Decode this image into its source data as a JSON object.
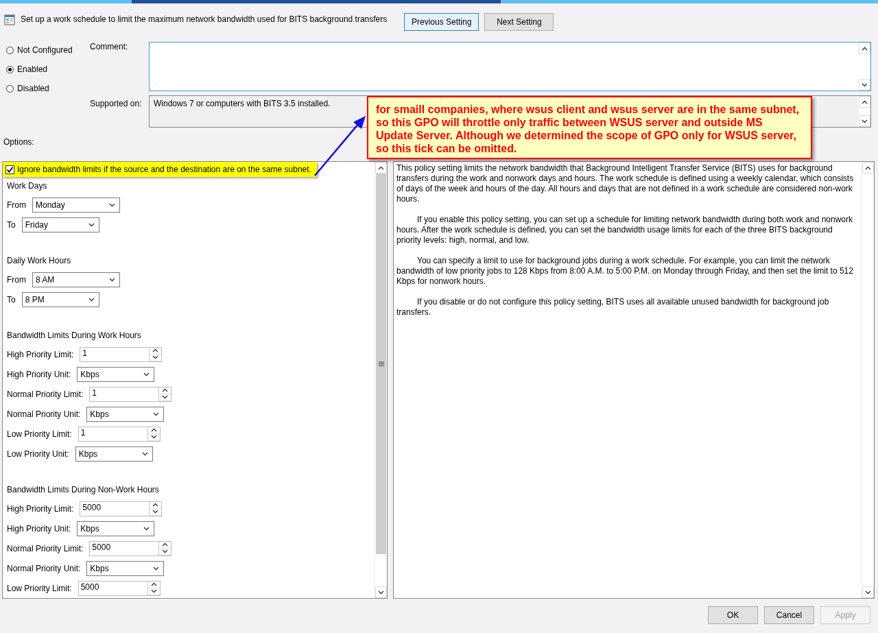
{
  "window": {
    "title": "Set up a work schedule to limit the maximum network bandwidth used for BITS background transfers"
  },
  "nav_buttons": [
    {
      "label": "Previous Setting",
      "focused": true
    },
    {
      "label": "Next Setting",
      "focused": false
    }
  ],
  "state_options": [
    {
      "label": "Not Configured",
      "selected": false
    },
    {
      "label": "Enabled",
      "selected": true
    },
    {
      "label": "Disabled",
      "selected": false
    }
  ],
  "comment": {
    "label": "Comment:"
  },
  "supported_on": {
    "label": "Supported on:",
    "value": "Windows 7 or computers with BITS 3.5 installed."
  },
  "options_label": "Options:",
  "options": [
    {
      "kind": "checkbox",
      "label": "Ignore bandwidth limits if the source and the destination are on the same subnet.",
      "checked": true,
      "highlighted": true
    },
    {
      "kind": "heading",
      "label": "Work Days"
    },
    {
      "kind": "dropdown",
      "label": "From",
      "value": "Monday"
    },
    {
      "kind": "dropdown",
      "label": "To",
      "value": "Friday"
    },
    {
      "kind": "heading",
      "label": "Daily Work Hours"
    },
    {
      "kind": "dropdown",
      "label": "From",
      "value": "8 AM"
    },
    {
      "kind": "dropdown",
      "label": "To",
      "value": "8 PM"
    },
    {
      "kind": "heading",
      "label": "Bandwidth Limits During Work Hours"
    },
    {
      "kind": "spinner",
      "label": "High Priority Limit:",
      "value": "1"
    },
    {
      "kind": "dropdown",
      "label": "High Priority Unit:",
      "value": "Kbps"
    },
    {
      "kind": "spinner",
      "label": "Normal Priority Limit:",
      "value": "1"
    },
    {
      "kind": "dropdown",
      "label": "Normal Priority Unit:",
      "value": "Kbps"
    },
    {
      "kind": "spinner",
      "label": "Low Priority Limit:",
      "value": "1"
    },
    {
      "kind": "dropdown",
      "label": "Low Priority Unit:",
      "value": "Kbps"
    },
    {
      "kind": "heading",
      "label": "Bandwidth Limits During Non-Work Hours"
    },
    {
      "kind": "spinner",
      "label": "High Priority Limit:",
      "value": "5000"
    },
    {
      "kind": "dropdown",
      "label": "High Priority Unit:",
      "value": "Kbps"
    },
    {
      "kind": "spinner",
      "label": "Normal Priority Limit:",
      "value": "5000"
    },
    {
      "kind": "dropdown",
      "label": "Normal Priority Unit:",
      "value": "Kbps"
    },
    {
      "kind": "spinner",
      "label": "Low Priority Limit:",
      "value": "5000"
    }
  ],
  "help_paragraphs": [
    "This policy setting limits the network bandwidth that Background Intelligent Transfer Service (BITS) uses for background transfers during the work and nonwork days and hours. The work schedule is defined using a weekly calendar, which consists of days of the week and hours of the day. All hours and days that are not defined in a work schedule are considered non-work hours.",
    "If you enable this policy setting, you can set up a schedule for limiting network bandwidth during both work and nonwork hours. After the work schedule is defined, you can set the bandwidth usage limits for each of the three BITS background priority levels: high, normal, and low.",
    "You can specify a limit to use for background jobs during a work schedule. For example, you can limit the network bandwidth of low priority jobs to 128 Kbps from 8:00 A.M. to 5:00 P.M. on Monday through Friday, and then set the limit to 512 Kbps for nonwork hours.",
    "If you disable or do not configure this policy setting, BITS uses all available unused bandwidth for background job transfers."
  ],
  "annotation": {
    "text": "for smaill companies, where wsus client and wsus server are in the same subnet, so this GPO will throttle only traffic between WSUS server and outside MS Update Server. Although we determined the scope of GPO only for WSUS server, so this tick can be omitted."
  },
  "buttons": [
    {
      "label": "OK",
      "disabled": false
    },
    {
      "label": "Cancel",
      "disabled": false
    },
    {
      "label": "Apply",
      "disabled": true
    }
  ]
}
